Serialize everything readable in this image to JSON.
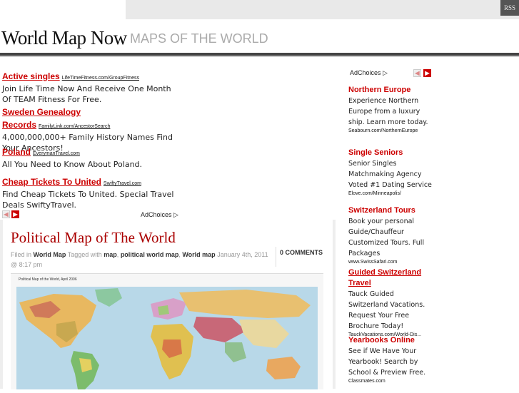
{
  "header": {
    "rss_label": "RSS",
    "site_title": "World Map Now",
    "tagline": "MAPS OF THE WORLD"
  },
  "left_ads": {
    "items": [
      {
        "title": "Active singles",
        "url": "LifeTimeFitness.com/GroupFitness",
        "desc": "Join Life Time Now And Receive One Month Of TEAM Fitness For Free."
      },
      {
        "title": "Sweden Genealogy Records",
        "url": "FamilyLink.com/AncestorSearch",
        "desc": "4,000,000,000+ Family History Names Find Your Ancestors!"
      },
      {
        "title": "Poland",
        "url": "EverymanTravel.com",
        "desc": "All You Need to Know About Poland."
      },
      {
        "title": "Cheap Tickets To United",
        "url": "SwiftyTravel.com",
        "desc": "Find Cheap Tickets To United. Special Travel Deals SwiftyTravel."
      }
    ],
    "adchoices": "AdChoices"
  },
  "post": {
    "title": "Political Map of The World",
    "filed_in_label": "Filed in",
    "category": "World Map",
    "tagged_label": "Tagged with",
    "tags": [
      "map",
      "political world map",
      "World map"
    ],
    "date": "January 4th, 2011 @ 8:17 pm",
    "comments": "0 COMMENTS",
    "map_caption": "Political Map of the World, April 2006"
  },
  "sidebar_ads": {
    "adchoices": "AdChoices",
    "items": [
      {
        "title": "Northern Europe",
        "desc": "Experience Northern Europe from a luxury ship. Learn more today.",
        "url": "Seabourn.com/NorthernEurope"
      },
      {
        "title": "Single Seniors",
        "desc": "Senior Singles Matchmaking Agency Voted #1 Dating Service",
        "url": "Elove.com/Minneapolis/"
      },
      {
        "title": "Switzerland Tours",
        "desc": "Book your personal Guide/Chauffeur Customized Tours. Full Packages",
        "url": "www.SwissSafari.com"
      },
      {
        "title": "Guided Switzerland Travel",
        "desc": "Tauck Guided Switzerland Vacations. Request Your Free Brochure Today!",
        "url": "TauckVacations.com/World-Dis..."
      },
      {
        "title": "Yearbooks Online",
        "desc": "See if We Have Your Yearbook! Search by School & Preview Free.",
        "url": "Classmates.com"
      }
    ]
  },
  "colors": {
    "accent": "#cc0000",
    "title_red": "#aa0000",
    "rule": "#444444"
  }
}
